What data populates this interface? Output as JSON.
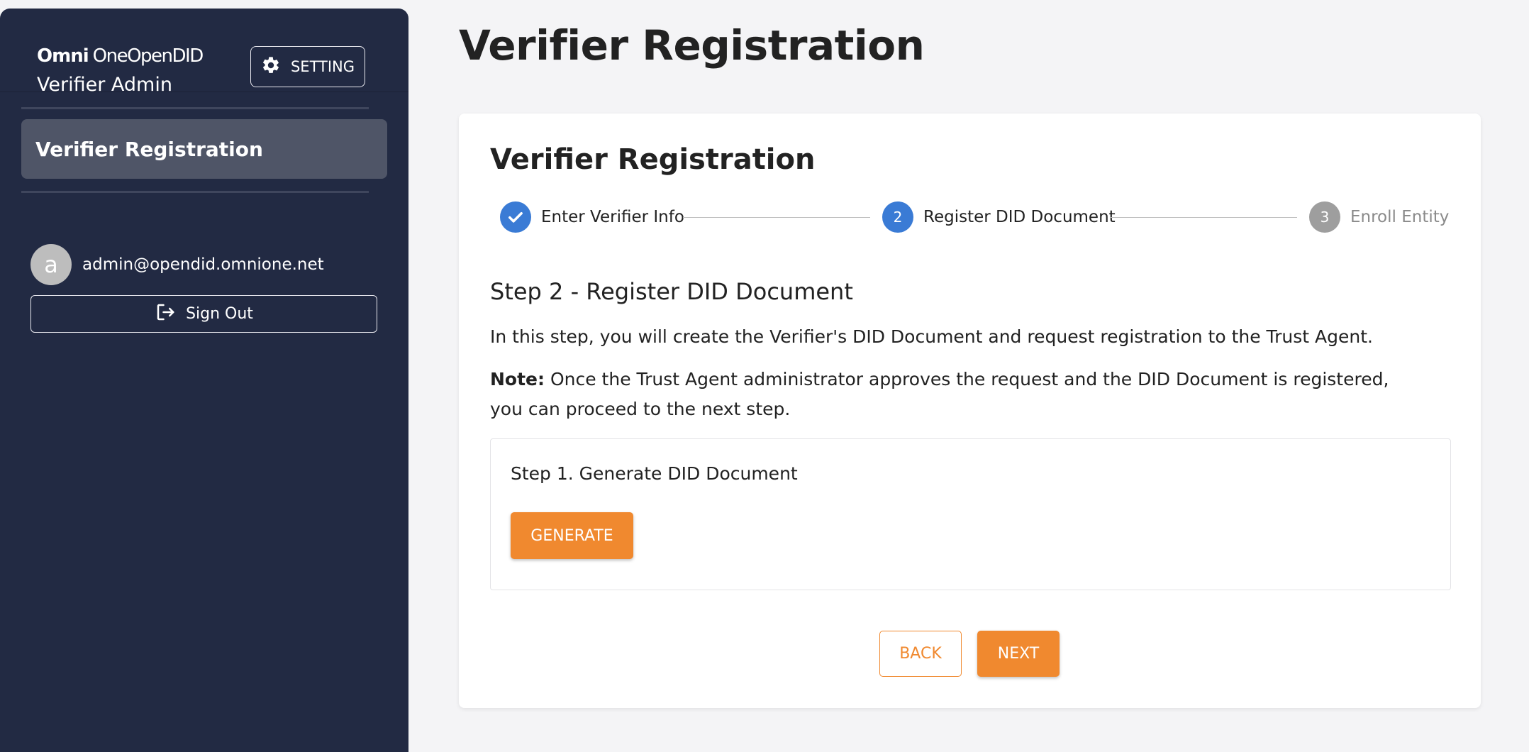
{
  "sidebar": {
    "logo_mark": "Omni",
    "logo_text": "OneOpenDID",
    "app_name": "Verifier Admin",
    "setting_label": "SETTING",
    "nav_items": [
      {
        "label": "Verifier Registration",
        "active": true,
        "icon": "none"
      }
    ],
    "user": {
      "avatar_initial": "a",
      "email": "admin@opendid.omnione.net"
    },
    "signout_label": "Sign Out",
    "icons": {
      "setting": "gear-icon",
      "signout": "logout-icon"
    }
  },
  "main": {
    "page_title": "Verifier Registration",
    "card": {
      "title": "Verifier Registration",
      "steps": [
        {
          "number": "1",
          "label": "Enter Verifier Info",
          "state": "completed"
        },
        {
          "number": "2",
          "label": "Register DID Document",
          "state": "active"
        },
        {
          "number": "3",
          "label": "Enroll Entity",
          "state": "pending"
        }
      ],
      "section_heading": "Step 2 - Register DID Document",
      "intro": "In this step, you will create the Verifier's DID Document and request registration to the Trust Agent.",
      "note_label": "Note:",
      "note_text_line1": " Once the Trust Agent administrator approves the request and the DID Document is registered,",
      "note_text_line2": "you can proceed to the next step.",
      "generate_box": {
        "title": "Step 1. Generate DID Document",
        "button_label": "GENERATE"
      },
      "back_label": "BACK",
      "next_label": "NEXT"
    }
  },
  "colors": {
    "sidebar_bg": "#222a43",
    "nav_active_bg": "#4f5567",
    "accent_orange": "#f0892f",
    "step_active": "#3a7bd5",
    "step_pending": "#9e9e9e",
    "page_bg": "#f4f4f6"
  }
}
